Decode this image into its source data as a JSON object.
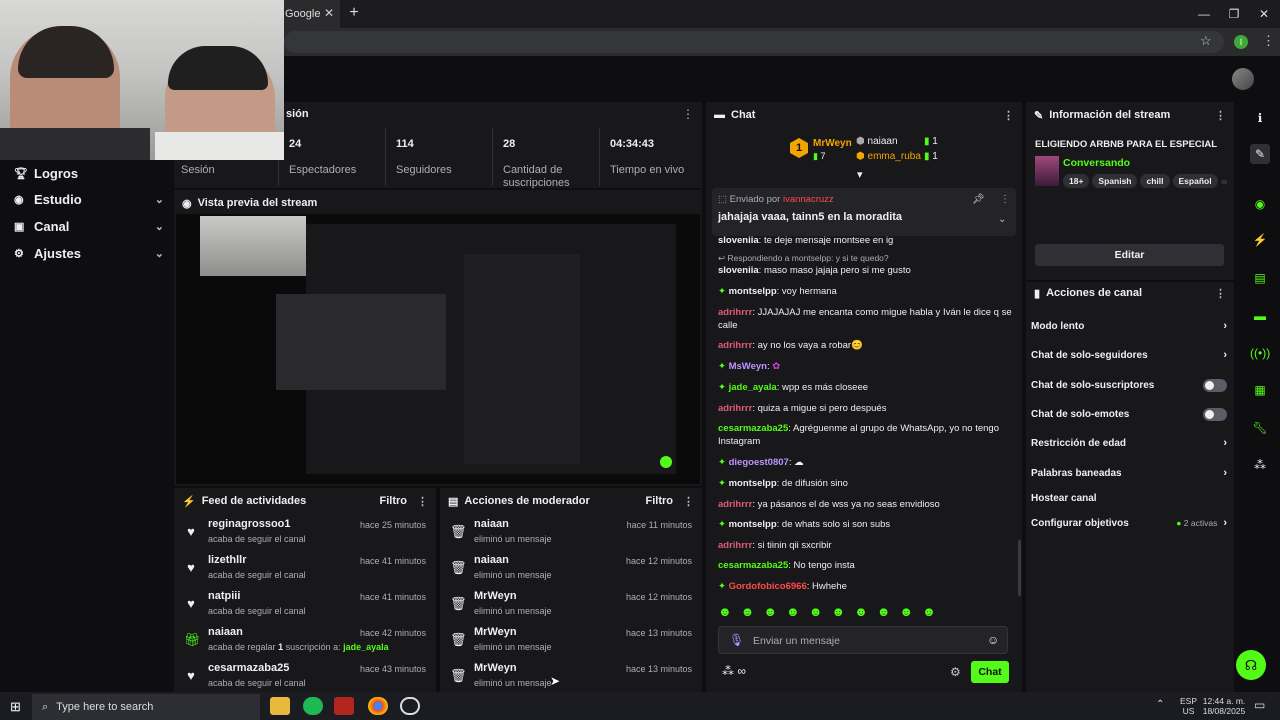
{
  "browser": {
    "tab_title": "Google",
    "tab_close": "✕",
    "new_tab": "+",
    "minimize": "—",
    "restore": "❐",
    "close": "✕",
    "star": "☆",
    "profile_initial": "I",
    "menu": "⋮"
  },
  "nav": {
    "items": [
      {
        "label": "Logros",
        "icon": "trophy-icon"
      },
      {
        "label": "Estudio",
        "icon": "studio-icon"
      },
      {
        "label": "Canal",
        "icon": "channel-icon"
      },
      {
        "label": "Ajustes",
        "icon": "settings-icon"
      }
    ]
  },
  "session": {
    "title": "sión",
    "label": "Sesión",
    "stats": [
      {
        "num": "24",
        "label": "Espectadores"
      },
      {
        "num": "114",
        "label": "Seguidores"
      },
      {
        "num": "28",
        "label": "Cantidad de suscripciones"
      },
      {
        "num": "04:34:43",
        "label": "Tiempo en vivo"
      }
    ]
  },
  "preview": {
    "title": "Vista previa del stream"
  },
  "feed": {
    "title": "Feed de actividades",
    "filter": "Filtro",
    "items": [
      {
        "name": "reginagrossoo1",
        "sub": "acaba de seguir el canal",
        "time": "hace 25 minutos",
        "icon": "heart-icon"
      },
      {
        "name": "lizethllr",
        "sub": "acaba de seguir el canal",
        "time": "hace 41 minutos",
        "icon": "heart-icon"
      },
      {
        "name": "natpiii",
        "sub": "acaba de seguir el canal",
        "time": "hace 41 minutos",
        "icon": "heart-icon"
      },
      {
        "name": "naiaan",
        "sub_a": "acaba de regalar ",
        "sub_b": "1",
        "sub_c": " suscripción a: ",
        "sub_d": "jade_ayala",
        "time": "hace 42 minutos",
        "icon": "gift-icon"
      },
      {
        "name": "cesarmazaba25",
        "sub": "acaba de seguir el canal",
        "time": "hace 43 minutos",
        "icon": "heart-icon"
      }
    ]
  },
  "mod": {
    "title": "Acciones de moderador",
    "filter": "Filtro",
    "items": [
      {
        "name": "naiaan",
        "sub": "eliminó un mensaje",
        "time": "hace 11 minutos"
      },
      {
        "name": "naiaan",
        "sub": "eliminó un mensaje",
        "time": "hace 12 minutos"
      },
      {
        "name": "MrWeyn",
        "sub": "eliminó un mensaje",
        "time": "hace 12 minutos"
      },
      {
        "name": "MrWeyn",
        "sub": "eliminó un mensaje",
        "time": "hace 13 minutos"
      },
      {
        "name": "MrWeyn",
        "sub": "eliminó un mensaje",
        "time": "hace 13 minutos"
      }
    ]
  },
  "chat": {
    "title": "Chat",
    "leaders": {
      "first": {
        "name": "MrWeyn",
        "count": "7",
        "rank": "1"
      },
      "second": {
        "name": "naiaan",
        "count": "1"
      },
      "third": {
        "name": "emma_ruba",
        "count": "1"
      }
    },
    "pinned": {
      "by": "Enviado por",
      "user": "ivannacruzz",
      "text": "jahajaja vaaa, tainn5 en la moradita"
    },
    "reply_note": "Respondiendo a montselpp: y si te quedo?",
    "lines": [
      {
        "user": "sloveniia",
        "color": "#efeff1",
        "text": ": te deje mensaje montsee en ig"
      },
      {
        "user": "sloveniia",
        "color": "#efeff1",
        "text": ": maso maso jajaja pero si me gusto"
      },
      {
        "user": "montselpp",
        "color": "#efeff1",
        "text": ": voy hermana",
        "badge": true
      },
      {
        "user": "adrihrrr",
        "color": "#e05c7a",
        "text": ": JJAJAJAJ me encanta como migue habla y Iván le dice q se calle"
      },
      {
        "user": "adrihrrr",
        "color": "#e05c7a",
        "text": ": ay no los vaya a robar😊"
      },
      {
        "user": "MsWeyn",
        "color": "#bf94ff",
        "text": ":",
        "badge": true
      },
      {
        "user": "jade_ayala",
        "color": "#53fc18",
        "text": ": wpp es más closeee",
        "badge": true
      },
      {
        "user": "adrihrrr",
        "color": "#e05c7a",
        "text": ": quiza a migue si pero después"
      },
      {
        "user": "cesarmazaba25",
        "color": "#53fc18",
        "text": ": Agréguenme al grupo de WhatsApp, yo no tengo Instagram"
      },
      {
        "user": "diegoest0807",
        "color": "#bf94ff",
        "text": ":",
        "badge": true
      },
      {
        "user": "montselpp",
        "color": "#efeff1",
        "text": ": de difusión sino",
        "badge": true
      },
      {
        "user": "adrihrrr",
        "color": "#e05c7a",
        "text": ": ya pásanos el de wss ya no seas envidioso"
      },
      {
        "user": "montselpp",
        "color": "#efeff1",
        "text": ": de whats solo si son subs",
        "badge": true
      },
      {
        "user": "adrihrrr",
        "color": "#e05c7a",
        "text": ": si tiinin qii sxcribir"
      },
      {
        "user": "cesarmazaba25",
        "color": "#53fc18",
        "text": ": No tengo insta"
      },
      {
        "user": "Gordofobico6966",
        "color": "#ff4a4a",
        "text": ": Hwhehe",
        "badge": true
      }
    ],
    "input_placeholder": "Enviar un mensaje",
    "send": "Chat",
    "accent": "#53fc18"
  },
  "info": {
    "title": "Información del stream",
    "stream_title": "ELIGIENDO ARBNB PARA EL ESPECIAL",
    "category": "Conversando",
    "tags": [
      "18+",
      "Spanish",
      "chill",
      "Español"
    ],
    "edit": "Editar"
  },
  "actions": {
    "title": "Acciones de canal",
    "items": [
      {
        "label": "Modo lento",
        "type": "arrow"
      },
      {
        "label": "Chat de solo-seguidores",
        "type": "arrow"
      },
      {
        "label": "Chat de solo-suscriptores",
        "type": "toggle"
      },
      {
        "label": "Chat de solo-emotes",
        "type": "toggle"
      },
      {
        "label": "Restricción de edad",
        "type": "arrow"
      },
      {
        "label": "Palabras baneadas",
        "type": "arrow"
      },
      {
        "label": "Hostear canal",
        "type": "none"
      },
      {
        "label": "Configurar objetivos",
        "type": "arrow",
        "extra": "2 activas"
      }
    ]
  },
  "taskbar": {
    "search": "Type here to search",
    "lang1": "ESP",
    "lang2": "US",
    "time": "12:44 a. m.",
    "date": "18/08/2025"
  }
}
